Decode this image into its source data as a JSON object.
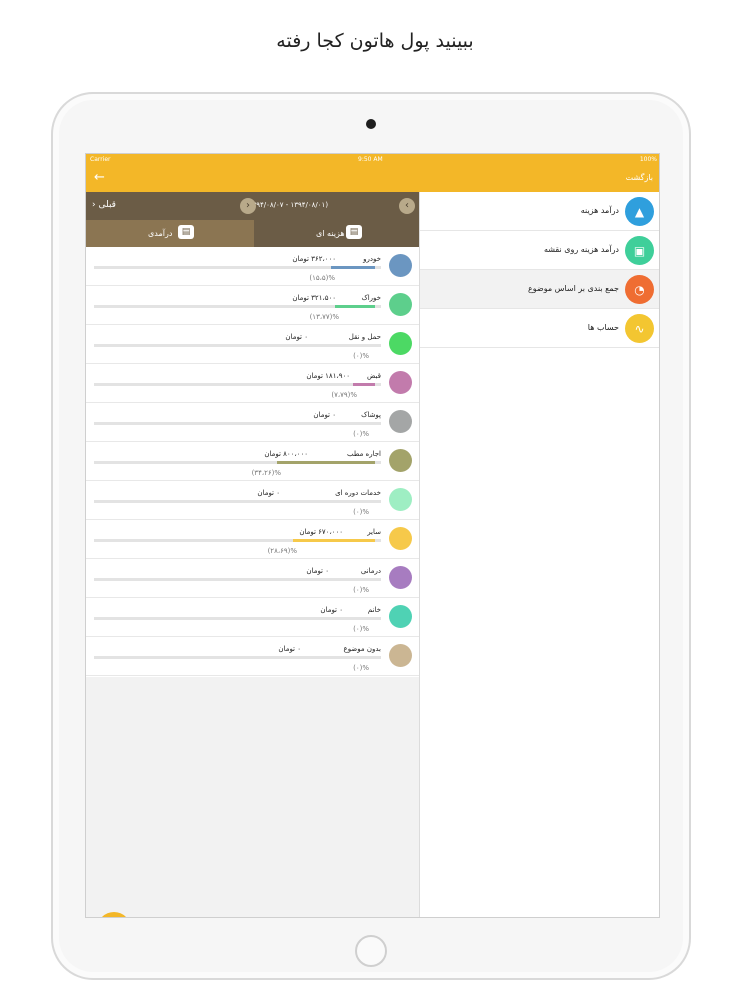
{
  "headline": "ببینید پول هاتون کجا رفته",
  "colors": {
    "accent": "#f3b728",
    "header_brown": "#6b5c46",
    "tab_brown": "#8b7552"
  },
  "status_bar": {
    "carrier": "Carrier",
    "time": "9:50 AM",
    "battery": "100%"
  },
  "nav": {
    "back_icon": "arrow-left-icon",
    "title": "بازگشت"
  },
  "sidebar": {
    "items": [
      {
        "label": "درآمد هزینه",
        "icon": "area-chart-icon",
        "color": "#2f9fdd"
      },
      {
        "label": "درآمد هزینه روی نقشه",
        "icon": "map-icon",
        "color": "#3fcf9a"
      },
      {
        "label": "جمع بندی بر اساس موضوع",
        "icon": "pie-chart-icon",
        "color": "#ef6d32",
        "active": true
      },
      {
        "label": "حساب ها",
        "icon": "line-chart-icon",
        "color": "#f3c631"
      }
    ]
  },
  "panel": {
    "date_range": "(۱۳۹۴/۰۸/۰۱ - ۱۳۹۴/۰۸/۰۷)",
    "prev_label": "قبلی",
    "tabs": {
      "expense": "هزینه ای",
      "income": "درآمدی"
    },
    "rows": [
      {
        "name": "خودرو",
        "amount": "۳۶۲،۰۰۰ تومان",
        "percent": "(۱۵،۵)%",
        "fraction": 0.155,
        "color": "#6b96c1"
      },
      {
        "name": "خوراک",
        "amount": "۳۲۱،۵۰۰ تومان",
        "percent": "(۱۳،۷۷)%",
        "fraction": 0.138,
        "color": "#5dcf8c"
      },
      {
        "name": "حمل و نقل",
        "amount": "۰ تومان",
        "percent": "(۰)%",
        "fraction": 0,
        "color": "#4cd964"
      },
      {
        "name": "قبض",
        "amount": "۱۸۱،۹۰۰ تومان",
        "percent": "(۷،۷۹)%",
        "fraction": 0.078,
        "color": "#c27bac"
      },
      {
        "name": "پوشاک",
        "amount": "۰ تومان",
        "percent": "(۰)%",
        "fraction": 0,
        "color": "#a4a6a6"
      },
      {
        "name": "اجاره مطب",
        "amount": "۸۰۰،۰۰۰ تومان",
        "percent": "(۳۴،۲۶)%",
        "fraction": 0.343,
        "color": "#a3a36a"
      },
      {
        "name": "خدمات دوره ای",
        "amount": "۰ تومان",
        "percent": "(۰)%",
        "fraction": 0,
        "color": "#9eeec3"
      },
      {
        "name": "سایر",
        "amount": "۶۷۰،۰۰۰ تومان",
        "percent": "(۲۸،۶۹)%",
        "fraction": 0.287,
        "color": "#f6c94a"
      },
      {
        "name": "درمانی",
        "amount": "۰ تومان",
        "percent": "(۰)%",
        "fraction": 0,
        "color": "#a77cc0"
      },
      {
        "name": "خانم",
        "amount": "۰ تومان",
        "percent": "(۰)%",
        "fraction": 0,
        "color": "#4fd2b4"
      },
      {
        "name": "بدون موضوع",
        "amount": "۰ تومان",
        "percent": "(۰)%",
        "fraction": 0,
        "color": "#cbb693"
      }
    ]
  },
  "fab_icon": "pie-chart-icon"
}
